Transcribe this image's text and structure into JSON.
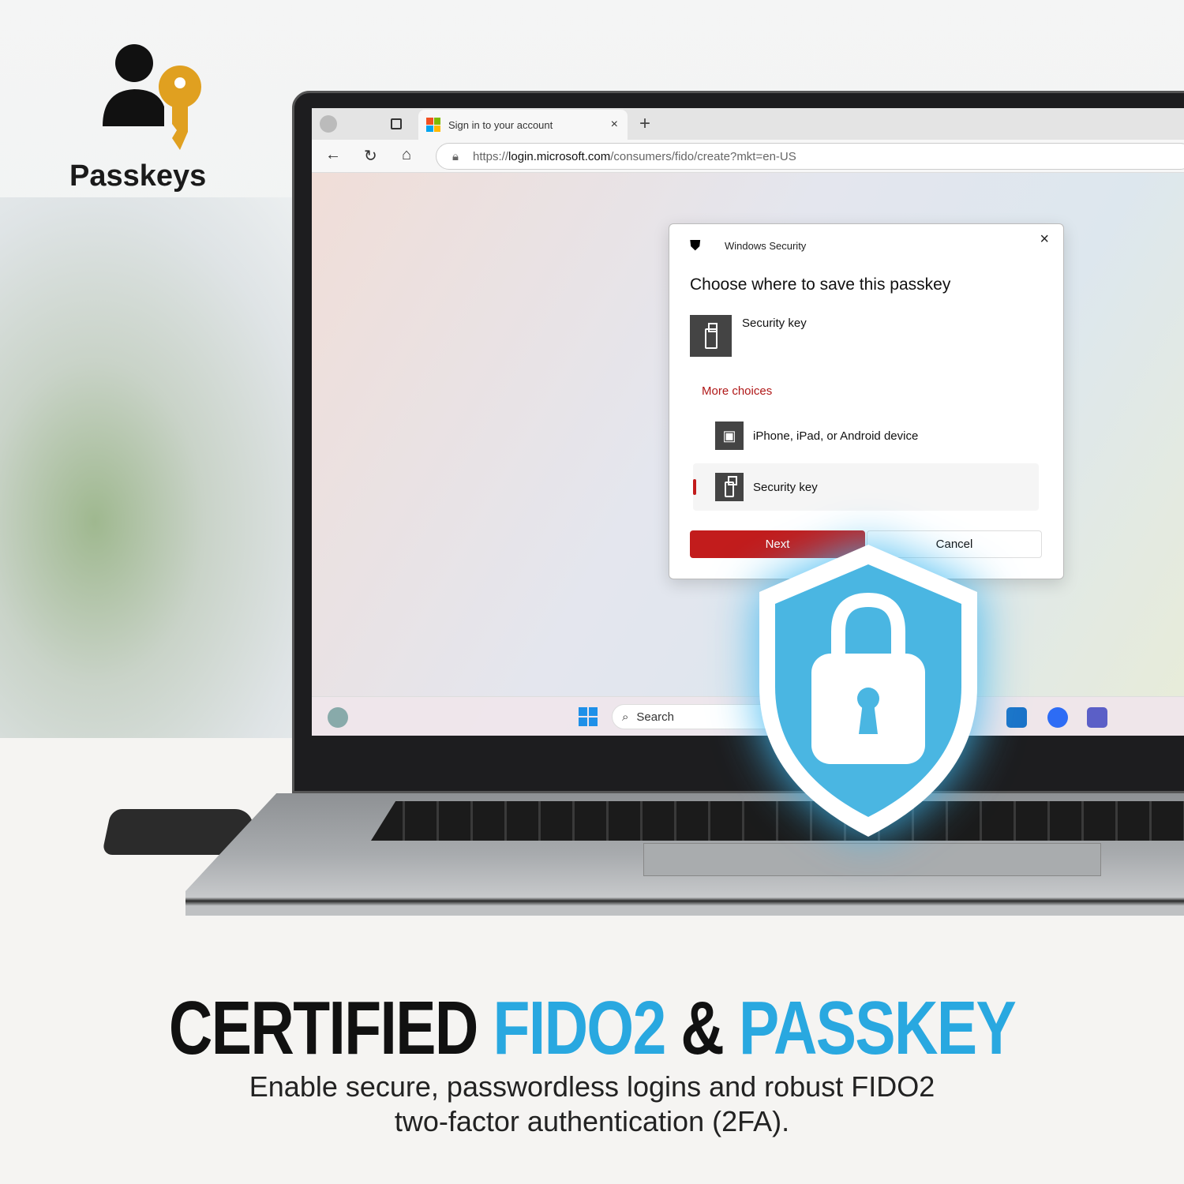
{
  "brand": {
    "logo_label": "Passkeys",
    "key_color": "#e0a020"
  },
  "browser": {
    "tab_title": "Sign in to your account",
    "close_tab": "×",
    "new_tab": "+",
    "url_scheme": "https://",
    "url_host": "login.microsoft.com",
    "url_path": "/consumers/fido/create?mkt=en-US"
  },
  "dialog": {
    "app_title": "Windows Security",
    "close": "×",
    "heading": "Choose where to save this passkey",
    "primary_option": "Security key",
    "more_choices": "More choices",
    "options": [
      {
        "label": "iPhone, iPad, or Android device",
        "icon": "qr-code-icon",
        "selected": false
      },
      {
        "label": "Security key",
        "icon": "usb-key-icon",
        "selected": true
      }
    ],
    "next_label": "Next",
    "cancel_label": "Cancel",
    "accent": "#c21c1c"
  },
  "taskbar": {
    "search_label": "Search"
  },
  "marketing": {
    "headline_1": "CERTIFIED ",
    "headline_2": "FIDO2",
    "headline_3": " & ",
    "headline_4": "PASSKEY",
    "subline_1": "Enable secure, passwordless logins and robust FIDO2",
    "subline_2": "two-factor authentication (2FA).",
    "accent": "#29a8e0"
  }
}
